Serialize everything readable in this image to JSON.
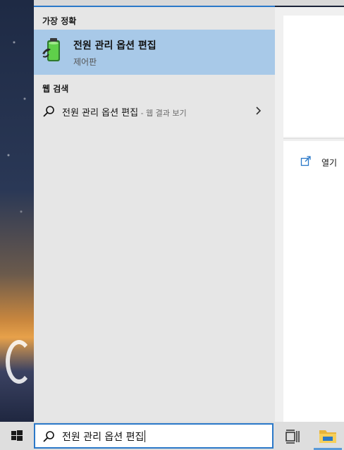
{
  "best_match": {
    "section_title": "가장 정확",
    "title": "전원 관리 옵션 편집",
    "subtitle": "제어판",
    "icon": "battery-power-icon"
  },
  "web_search": {
    "section_title": "웹 검색",
    "query": "전원 관리 옵션 편집",
    "suffix": " - 웹 결과 보기"
  },
  "preview": {
    "open_label": "열기"
  },
  "taskbar": {
    "search_value": "전원 관리 옵션 편집",
    "accent_color": "#2a78c8"
  }
}
